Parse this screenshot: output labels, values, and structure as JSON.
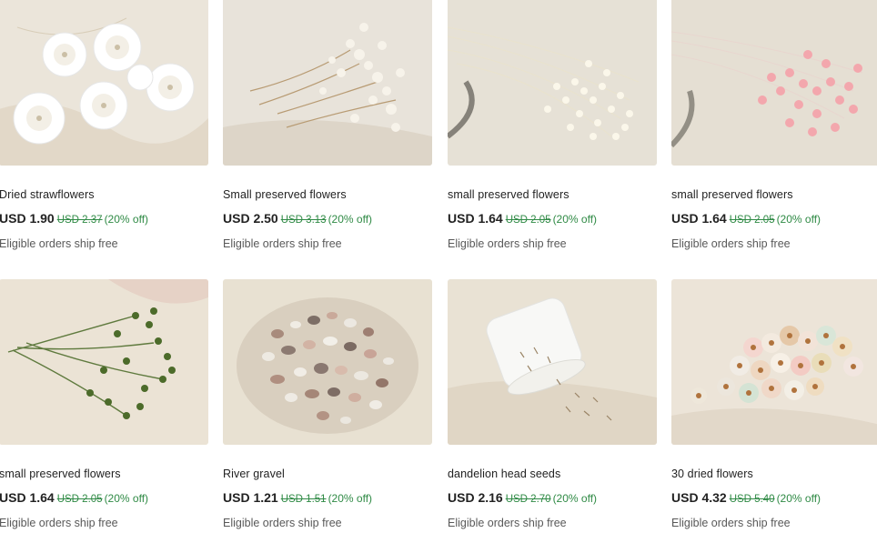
{
  "products": [
    {
      "image_icon": "white-strawflowers-photo",
      "title": "Dried strawflowers",
      "price": "USD 1.90",
      "original_price": "USD 2.37",
      "discount": "(20% off)",
      "shipping": "Eligible orders ship free"
    },
    {
      "image_icon": "preserved-flowers-cream-photo",
      "title": "Small preserved flowers",
      "price": "USD 2.50",
      "original_price": "USD 3.13",
      "discount": "(20% off)",
      "shipping": "Eligible orders ship free"
    },
    {
      "image_icon": "preserved-flowers-white-photo",
      "title": "small preserved flowers",
      "price": "USD 1.64",
      "original_price": "USD 2.05",
      "discount": "(20% off)",
      "shipping": "Eligible orders ship free"
    },
    {
      "image_icon": "preserved-flowers-pink-photo",
      "title": "small preserved flowers",
      "price": "USD 1.64",
      "original_price": "USD 2.05",
      "discount": "(20% off)",
      "shipping": "Eligible orders ship free"
    },
    {
      "image_icon": "preserved-flowers-green-photo",
      "title": "small preserved flowers",
      "price": "USD 1.64",
      "original_price": "USD 2.05",
      "discount": "(20% off)",
      "shipping": "Eligible orders ship free"
    },
    {
      "image_icon": "river-gravel-photo",
      "title": "River gravel",
      "price": "USD 1.21",
      "original_price": "USD 1.51",
      "discount": "(20% off)",
      "shipping": "Eligible orders ship free"
    },
    {
      "image_icon": "dandelion-seeds-photo",
      "title": "dandelion head seeds",
      "price": "USD 2.16",
      "original_price": "USD 2.70",
      "discount": "(20% off)",
      "shipping": "Eligible orders ship free"
    },
    {
      "image_icon": "dried-daisies-photo",
      "title": "30 dried flowers",
      "price": "USD 4.32",
      "original_price": "USD 5.40",
      "discount": "(20% off)",
      "shipping": "Eligible orders ship free"
    }
  ],
  "colors": {
    "price_text": "#222222",
    "discount_green": "#2f8a45",
    "muted_text": "#595959",
    "photo_background": "#ece6da"
  }
}
